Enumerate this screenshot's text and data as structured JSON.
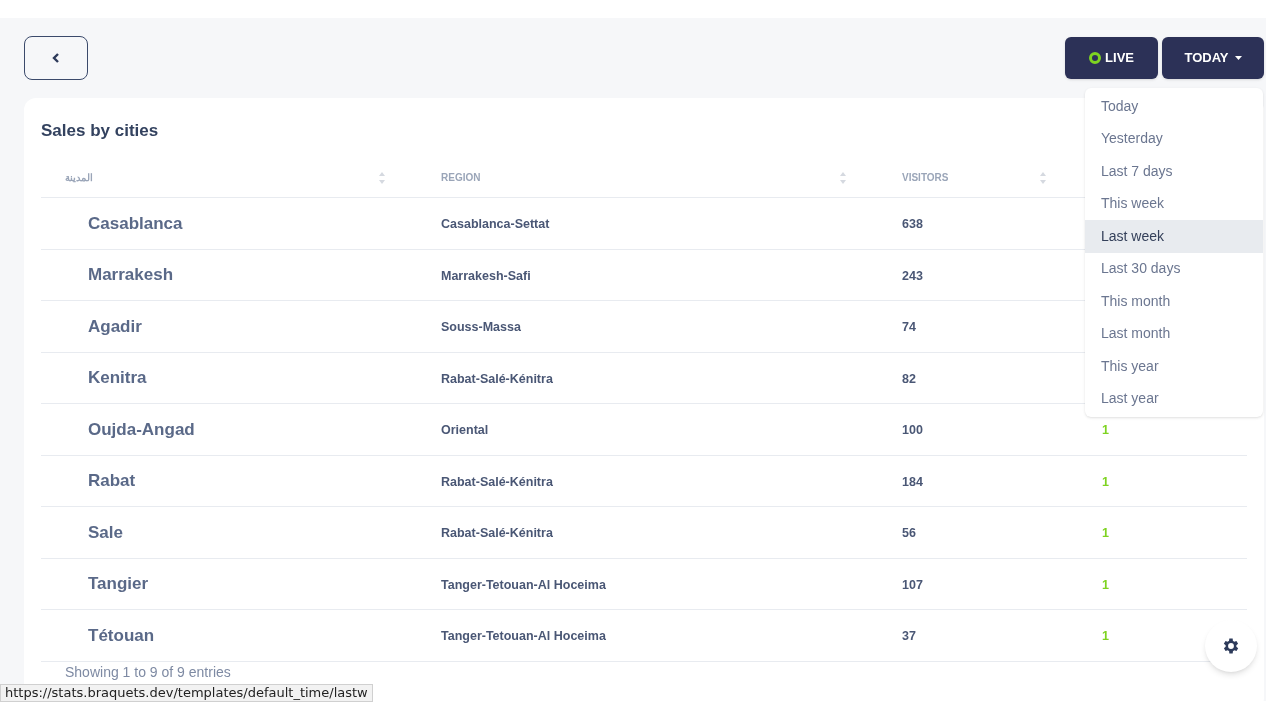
{
  "toolbar": {
    "live_button": "LIVE",
    "range_button": "TODAY"
  },
  "range_menu": [
    {
      "label": "Today",
      "selected": false
    },
    {
      "label": "Yesterday",
      "selected": false
    },
    {
      "label": "Last 7 days",
      "selected": false
    },
    {
      "label": "This week",
      "selected": false
    },
    {
      "label": "Last week",
      "selected": true
    },
    {
      "label": "Last 30 days",
      "selected": false
    },
    {
      "label": "This month",
      "selected": false
    },
    {
      "label": "Last month",
      "selected": false
    },
    {
      "label": "This year",
      "selected": false
    },
    {
      "label": "Last year",
      "selected": false
    }
  ],
  "card": {
    "title": "Sales by cities",
    "columns": [
      "المدينة",
      "REGION",
      "VISITORS"
    ],
    "rows": [
      {
        "city": "Casablanca",
        "region": "Casablanca-Settat",
        "visitors": "638"
      },
      {
        "city": "Marrakesh",
        "region": "Marrakesh-Safi",
        "visitors": "243"
      },
      {
        "city": "Agadir",
        "region": "Souss-Massa",
        "visitors": "74"
      },
      {
        "city": "Kenitra",
        "region": "Rabat-Salé-Kénitra",
        "visitors": "82"
      },
      {
        "city": "Oujda-Angad",
        "region": "Oriental",
        "visitors": "100",
        "column_4": "1"
      },
      {
        "city": "Rabat",
        "region": "Rabat-Salé-Kénitra",
        "visitors": "184",
        "column_4": "1"
      },
      {
        "city": "Sale",
        "region": "Rabat-Salé-Kénitra",
        "visitors": "56",
        "column_4": "1"
      },
      {
        "city": "Tangier",
        "region": "Tanger-Tetouan-Al Hoceima",
        "visitors": "107",
        "column_4": "1"
      },
      {
        "city": "Tétouan",
        "region": "Tanger-Tetouan-Al Hoceima",
        "visitors": "37",
        "column_4": "1"
      }
    ],
    "footer": "Showing 1 to 9 of 9 entries"
  },
  "status_url": "https://stats.braquets.dev/templates/default_time/lastw"
}
